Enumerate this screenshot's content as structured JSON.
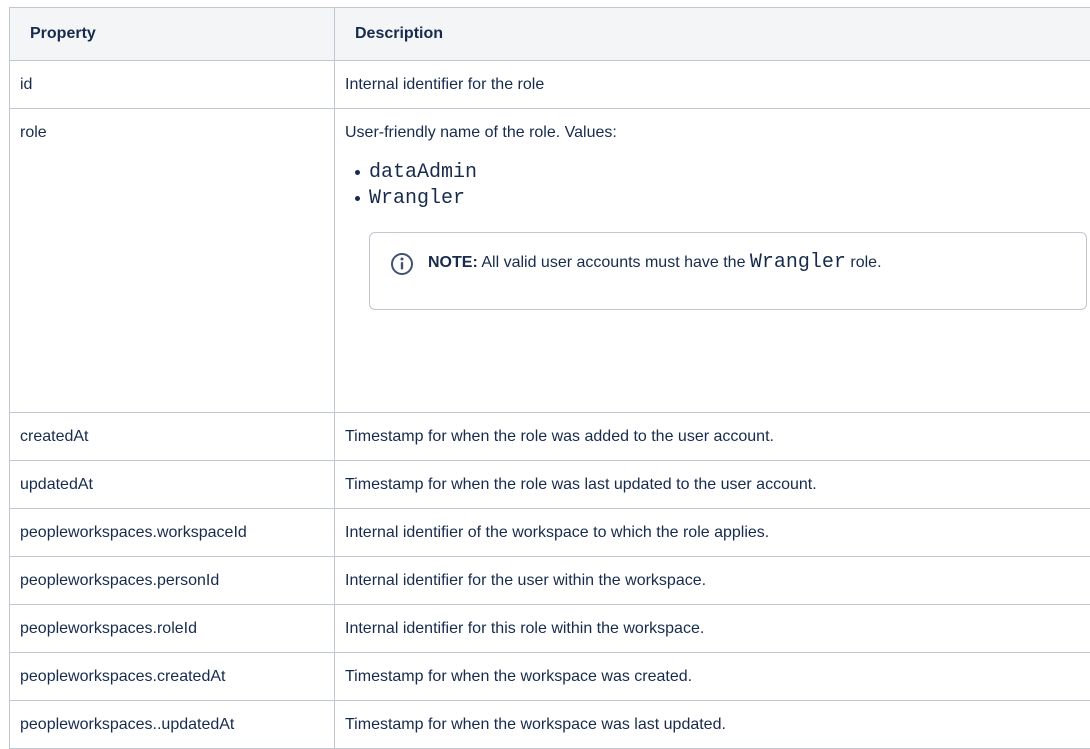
{
  "table": {
    "headers": [
      "Property",
      "Description"
    ],
    "rows": [
      {
        "property": "id",
        "description": "Internal identifier for the role"
      },
      {
        "property": "role",
        "description": "User-friendly name of the role. Values:",
        "values": [
          "dataAdmin",
          "Wrangler"
        ],
        "note": {
          "icon": "info-icon",
          "lead": "NOTE:",
          "text_before": " All valid user accounts must have the ",
          "code": "Wrangler",
          "text_after": " role."
        }
      },
      {
        "property": "createdAt",
        "description": "Timestamp for when the role was added to the user account."
      },
      {
        "property": "updatedAt",
        "description": "Timestamp for when the role was last updated to the user account."
      },
      {
        "property": "peopleworkspaces.workspaceId",
        "description": "Internal identifier of the workspace to which the role applies."
      },
      {
        "property": "peopleworkspaces.personId",
        "description": "Internal identifier for the user within the workspace."
      },
      {
        "property": "peopleworkspaces.roleId",
        "description": "Internal identifier for this role within the workspace."
      },
      {
        "property": "peopleworkspaces.createdAt",
        "description": "Timestamp for when the workspace was created."
      },
      {
        "property": "peopleworkspaces..updatedAt",
        "description": "Timestamp for when the workspace was last updated."
      }
    ]
  }
}
